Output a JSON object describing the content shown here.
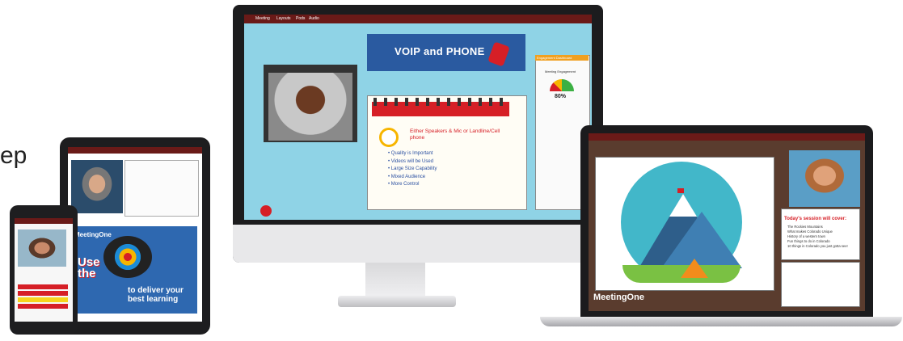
{
  "edge_text": "ep",
  "monitor": {
    "menu_items": [
      "Meeting",
      "Layouts",
      "Pods",
      "Audio"
    ],
    "slide_title": "VOIP and PHONE",
    "slide_subtitle": "Either Speakers & Mic or Landline/Cell phone",
    "bullets": [
      "Quality is Important",
      "Videos will be Used",
      "Large Size Capability",
      "Mixed Audience",
      "More Control"
    ],
    "engagement": {
      "panel_title": "Engagement Dashboard",
      "gauge_label": "Meeting Engagement",
      "percent": "80%"
    }
  },
  "laptop": {
    "agenda_title": "Today's session will cover:",
    "agenda_items": [
      "The Rockies Mountains",
      "What makes Colorado Unique",
      "History of a western town",
      "Fun things to do in Colorado",
      "10 things in Colorado you just gotta see!"
    ],
    "logo": "MeetingOne"
  },
  "tablet": {
    "logo": "MeetingOne",
    "poster_word_1": "Use",
    "poster_word_2": "the",
    "tagline_1": "to deliver your",
    "tagline_2": "best learning"
  },
  "colors": {
    "brand_red": "#d61f26",
    "menu_bar": "#6a1a18",
    "slide_blue": "#2a5aa0"
  }
}
